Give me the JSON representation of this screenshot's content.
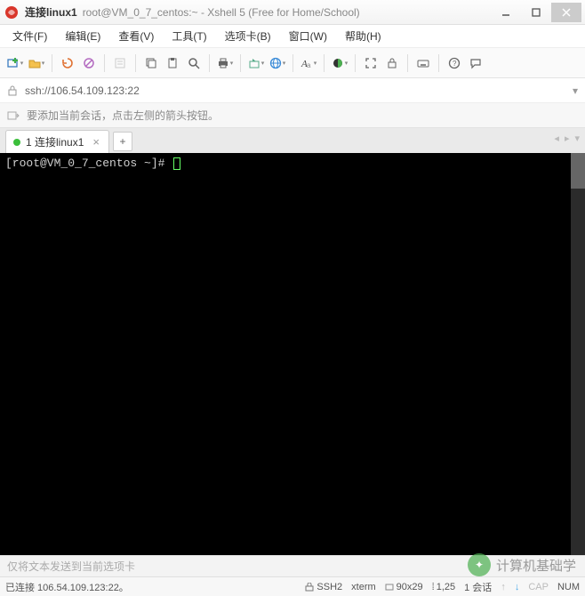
{
  "titlebar": {
    "session_name": "连接linux1",
    "rest": "root@VM_0_7_centos:~ - Xshell 5 (Free for Home/School)"
  },
  "menu": {
    "file": "文件(F)",
    "edit": "编辑(E)",
    "view": "查看(V)",
    "tools": "工具(T)",
    "tabs": "选项卡(B)",
    "window": "窗口(W)",
    "help": "帮助(H)"
  },
  "addressbar": {
    "url": "ssh://106.54.109.123:22"
  },
  "hint": {
    "text": "要添加当前会话，点击左侧的箭头按钮。"
  },
  "tabs": {
    "active_label": "1 连接linux1"
  },
  "terminal": {
    "prompt": "[root@VM_0_7_centos ~]#"
  },
  "sendbar": {
    "placeholder": "仅将文本发送到当前选项卡",
    "watermark": "计算机基础学"
  },
  "status": {
    "connected": "已连接 106.54.109.123:22。",
    "protocol": "SSH2",
    "termtype": "xterm",
    "size": "90x29",
    "cursor": "1,25",
    "sessions": "1 会话",
    "cap": "CAP",
    "num": "NUM"
  }
}
